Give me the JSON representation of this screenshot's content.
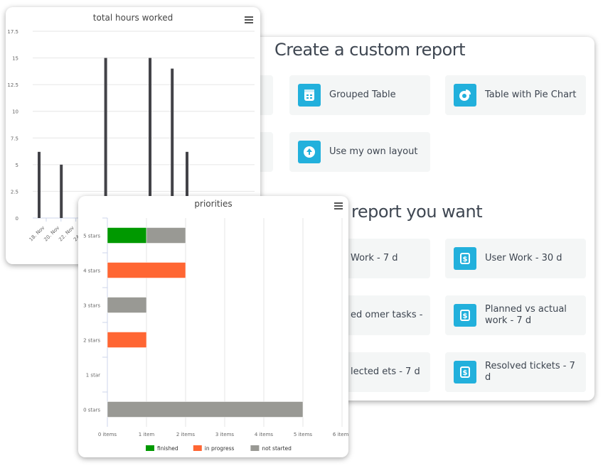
{
  "report_panel": {
    "custom_heading": "Create a custom report",
    "template_heading": "report you want",
    "custom_tiles": [
      {
        "label": "Grouped Table",
        "icon": "table-icon"
      },
      {
        "label": "Table with Pie Chart",
        "icon": "pie-chart-icon"
      },
      {
        "label": "Use my own layout",
        "icon": "upload-icon"
      }
    ],
    "template_tiles": [
      {
        "label": "Work - 7 d",
        "icon": "dollar-doc-icon"
      },
      {
        "label": "User Work - 30 d",
        "icon": "dollar-doc-icon"
      },
      {
        "label": "ed omer tasks -",
        "icon": "dollar-doc-icon"
      },
      {
        "label": "Planned vs actual work - 7 d",
        "icon": "dollar-doc-icon"
      },
      {
        "label": "lected ets - 7 d",
        "icon": "dollar-doc-icon"
      },
      {
        "label": "Resolved tickets - 7 d",
        "icon": "dollar-doc-icon"
      }
    ],
    "accent_color": "#22b0dc"
  },
  "chart_data": [
    {
      "type": "bar",
      "title": "total hours worked",
      "xlabel": "",
      "ylabel": "",
      "ylim": [
        0,
        17.5
      ],
      "yticks": [
        "0",
        "2.5",
        "5",
        "7.5",
        "10",
        "12.5",
        "15",
        "17.5"
      ],
      "xticks": [
        "18. Nov",
        "20. Nov",
        "22. Nov",
        "24. Nov"
      ],
      "x_day_offsets": [
        0,
        3,
        9,
        15,
        18,
        20
      ],
      "values": [
        6.2,
        5,
        15,
        15,
        14,
        6.2
      ],
      "bar_color": "#434348",
      "grid": true
    },
    {
      "type": "bar",
      "orientation": "horizontal",
      "stacked": true,
      "title": "priorities",
      "categories": [
        "5 stars",
        "4 stars",
        "3 stars",
        "2 stars",
        "1 star",
        "0 stars"
      ],
      "xticks": [
        "0 items",
        "1 item",
        "2 items",
        "3 items",
        "4 items",
        "5 items",
        "6 items"
      ],
      "xlim": [
        0,
        6
      ],
      "series": [
        {
          "name": "finished",
          "color": "#009900",
          "values": [
            1,
            0,
            0,
            0,
            0,
            0
          ]
        },
        {
          "name": "in progress",
          "color": "#ff6633",
          "values": [
            0,
            2,
            0,
            1,
            0,
            0
          ]
        },
        {
          "name": "not started",
          "color": "#999994",
          "values": [
            1,
            0,
            1,
            0,
            0,
            5
          ]
        }
      ],
      "legend": "bottom",
      "grid": true
    }
  ]
}
